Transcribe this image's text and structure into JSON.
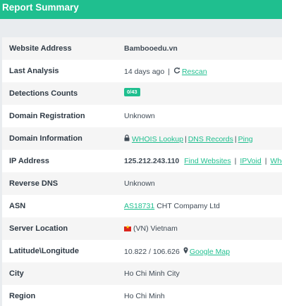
{
  "header": {
    "title": "Report Summary"
  },
  "colors": {
    "accent": "#1fbf8f",
    "flag_red": "#da251d",
    "flag_star": "#ffcd00"
  },
  "rows": {
    "website": {
      "label": "Website Address",
      "value": "Bambooedu.vn"
    },
    "last_analysis": {
      "label": "Last Analysis",
      "value": "14 days ago",
      "sep": "|",
      "rescan": "Rescan",
      "icon": "refresh-icon"
    },
    "detections": {
      "label": "Detections Counts",
      "badge": "0/43"
    },
    "domain_registration": {
      "label": "Domain Registration",
      "value": "Unknown"
    },
    "domain_information": {
      "label": "Domain Information",
      "icon": "lock-icon",
      "whois": "WHOIS Lookup",
      "sep": "|",
      "dns": "DNS Records",
      "ping": "Ping"
    },
    "ip_address": {
      "label": "IP Address",
      "value": "125.212.243.110",
      "find_websites": "Find Websites",
      "sep": "|",
      "ipvoid": "IPVoid",
      "whois": "Whois"
    },
    "reverse_dns": {
      "label": "Reverse DNS",
      "value": "Unknown"
    },
    "asn": {
      "label": "ASN",
      "asn_link": "AS18731",
      "owner": "CHT Compamy Ltd"
    },
    "server_location": {
      "label": "Server Location",
      "icon": "vietnam-flag-icon",
      "value": "(VN) Vietnam"
    },
    "lat_long": {
      "label": "Latitude\\Longitude",
      "value": "10.822 / 106.626",
      "icon": "map-pin-icon",
      "map_link": "Google Map"
    },
    "city": {
      "label": "City",
      "value": "Ho Chi Minh City"
    },
    "region": {
      "label": "Region",
      "value": "Ho Chi Minh"
    }
  }
}
